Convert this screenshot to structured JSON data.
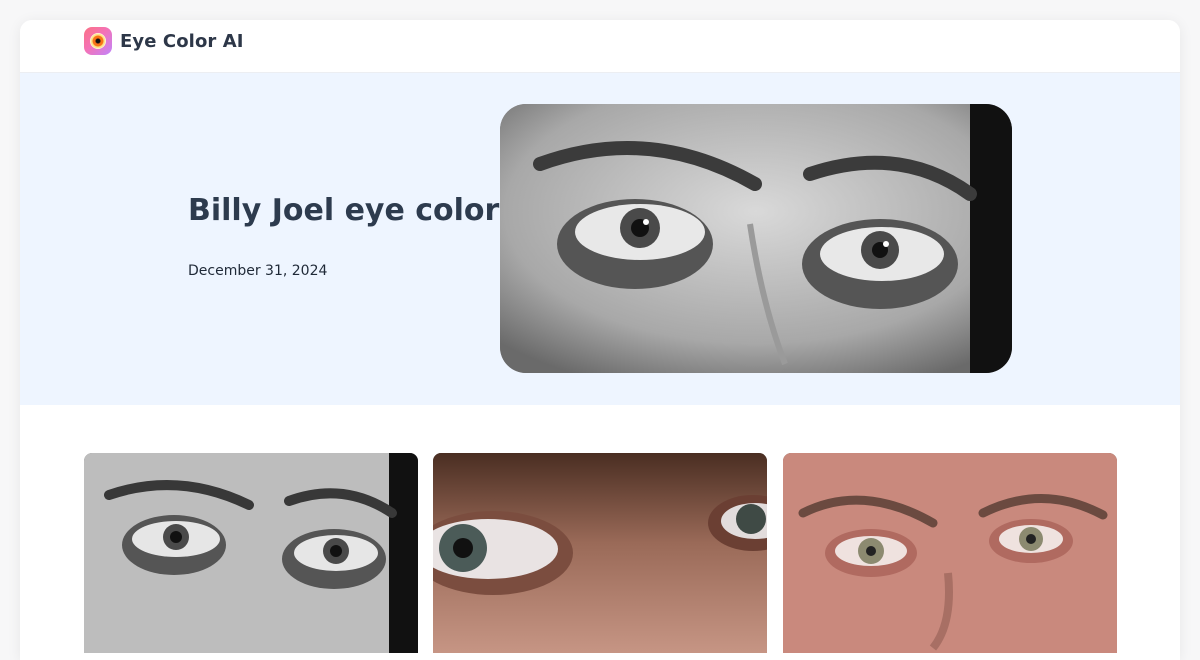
{
  "app": {
    "brand_name": "Eye Color AI",
    "logo_icon": "eye-logo-icon"
  },
  "hero": {
    "title": "Billy Joel eye color",
    "date": "December 31, 2024",
    "image_icon": "eyes-closeup-photo"
  },
  "gallery": {
    "items": [
      {
        "icon": "bw-eyes-photo"
      },
      {
        "icon": "color-eye-closeup-photo"
      },
      {
        "icon": "older-face-eyes-photo"
      }
    ]
  },
  "colors": {
    "hero_background": "#eef5ff",
    "title_text": "#2d3b4e",
    "brand_gradient_start": "#fb7185",
    "brand_gradient_end": "#c084fc"
  }
}
